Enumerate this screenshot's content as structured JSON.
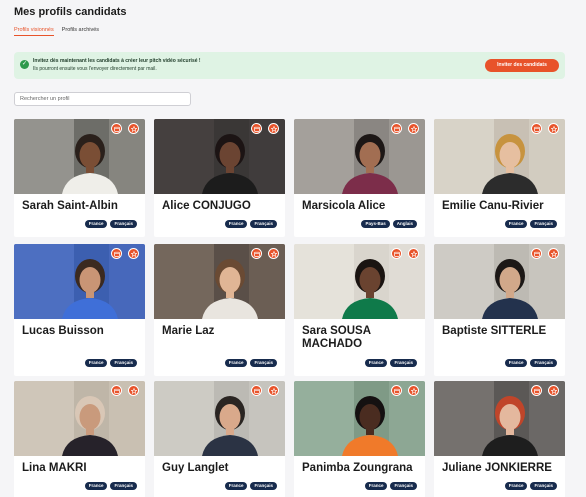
{
  "page": {
    "title": "Mes profils candidats",
    "tabs": [
      {
        "label": "Profils visionnés",
        "active": true
      },
      {
        "label": "Profils archivés",
        "active": false
      }
    ]
  },
  "banner": {
    "line1": "Invitez dès maintenant les candidats à créer leur pitch vidéo sécurisé !",
    "line2": "Ils pourront ensuite vous l'envoyer directement par mail.",
    "button_label": "Inviter des candidats"
  },
  "search": {
    "placeholder": "Rechercher un profil",
    "value": ""
  },
  "colors": {
    "accent": "#e8532a",
    "tag_bg": "#172b4d",
    "banner_bg": "#dff3e4"
  },
  "candidates": [
    {
      "name": "Sarah Saint-Albin",
      "tags": [
        "France",
        "Français"
      ]
    },
    {
      "name": "Alice CONJUGO",
      "tags": [
        "France",
        "Français"
      ]
    },
    {
      "name": "Marsicola Alice",
      "tags": [
        "Pays-Bas",
        "Anglais"
      ]
    },
    {
      "name": "Emilie Canu-Rivier",
      "tags": [
        "France",
        "Français"
      ]
    },
    {
      "name": "Lucas Buisson",
      "tags": [
        "France",
        "Français"
      ]
    },
    {
      "name": "Marie Laz",
      "tags": [
        "France",
        "Français"
      ]
    },
    {
      "name": "Sara SOUSA MACHADO",
      "tags": [
        "France",
        "Français"
      ]
    },
    {
      "name": "Baptiste SITTERLE",
      "tags": [
        "France",
        "Français"
      ]
    },
    {
      "name": "Lina MAKRI",
      "tags": [
        "France",
        "Français"
      ]
    },
    {
      "name": "Guy Langlet",
      "tags": [
        "France",
        "Français"
      ]
    },
    {
      "name": "Panimba Zoungrana",
      "tags": [
        "France",
        "Français"
      ]
    },
    {
      "name": "Juliane JONKIERRE",
      "tags": [
        "France",
        "Français"
      ]
    }
  ],
  "icons": {
    "calendar": "calendar-icon",
    "star": "star-icon",
    "check": "check-icon"
  }
}
